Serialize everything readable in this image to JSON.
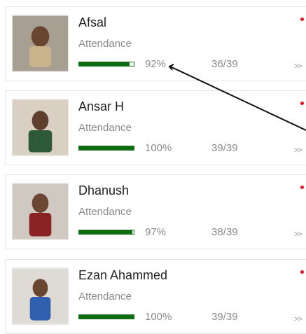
{
  "students": [
    {
      "name": "Afsal",
      "attendance_label": "Attendance",
      "percent_text": "92%",
      "fraction": 0.92,
      "ratio_text": "36/39",
      "chevron": ">>",
      "shirt": "#c9b38a",
      "skin": "#6a4631",
      "bg": "#a89f93"
    },
    {
      "name": "Ansar H",
      "attendance_label": "Attendance",
      "percent_text": "100%",
      "fraction": 1.0,
      "ratio_text": "39/39",
      "chevron": ">>",
      "shirt": "#2f5a3a",
      "skin": "#5e3e2c",
      "bg": "#d9cfc2"
    },
    {
      "name": "Dhanush",
      "attendance_label": "Attendance",
      "percent_text": "97%",
      "fraction": 0.97,
      "ratio_text": "38/39",
      "chevron": ">>",
      "shirt": "#8a2323",
      "skin": "#6b4632",
      "bg": "#cfc9c2"
    },
    {
      "name": "Ezan Ahammed",
      "attendance_label": "Attendance",
      "percent_text": "100%",
      "fraction": 1.0,
      "ratio_text": "39/39",
      "chevron": ">>",
      "shirt": "#2f5fae",
      "skin": "#6a4631",
      "bg": "#dedad4"
    }
  ],
  "colors": {
    "bar_fill": "#0d6b12",
    "status_dot": "#e0141b"
  }
}
